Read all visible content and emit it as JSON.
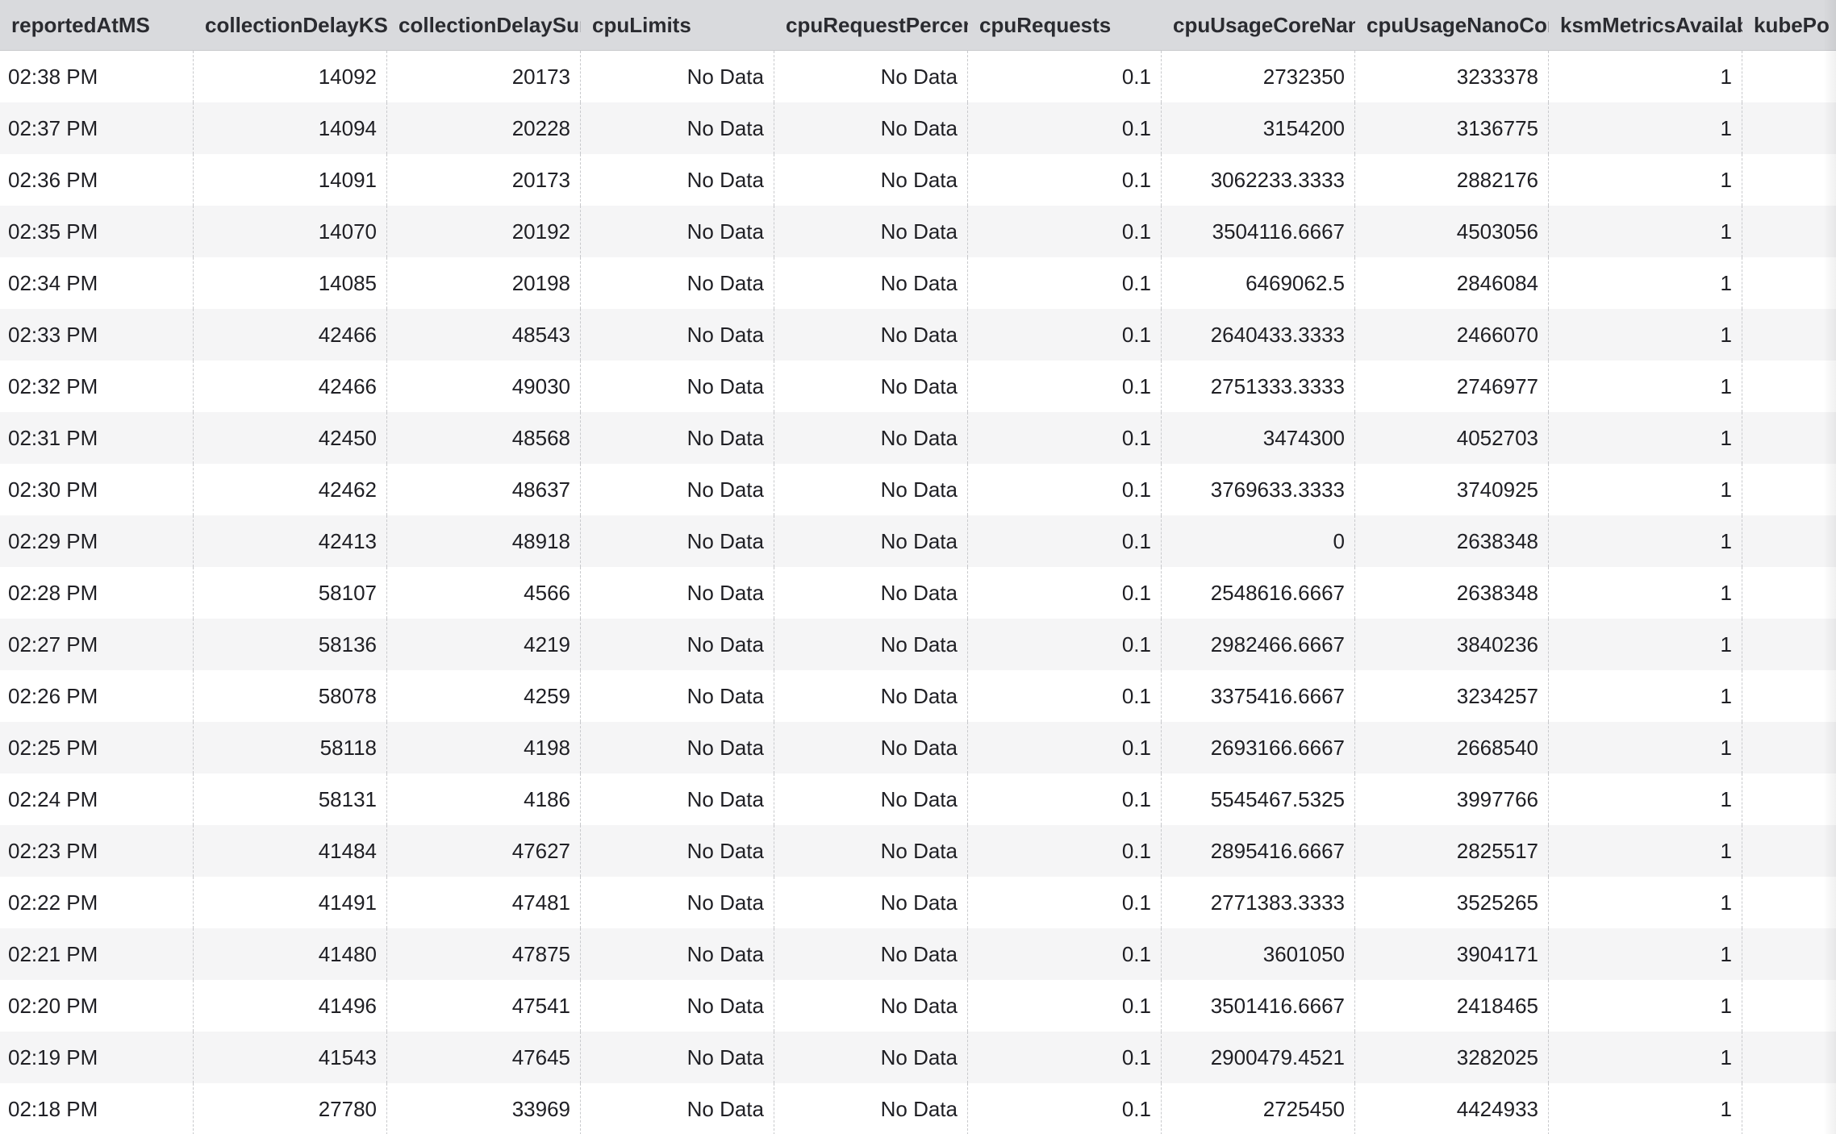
{
  "table": {
    "columns": [
      "reportedAtMS",
      "collectionDelayKSM",
      "collectionDelaySum",
      "cpuLimits",
      "cpuRequestPercent",
      "cpuRequests",
      "cpuUsageCoreNanos",
      "cpuUsageNanoCores",
      "ksmMetricsAvailable",
      "kubePo",
      ""
    ],
    "rows": [
      [
        "02:38 PM",
        "14092",
        "20173",
        "No Data",
        "No Data",
        "0.1",
        "2732350",
        "3233378",
        "1",
        "",
        ""
      ],
      [
        "02:37 PM",
        "14094",
        "20228",
        "No Data",
        "No Data",
        "0.1",
        "3154200",
        "3136775",
        "1",
        "",
        ""
      ],
      [
        "02:36 PM",
        "14091",
        "20173",
        "No Data",
        "No Data",
        "0.1",
        "3062233.3333",
        "2882176",
        "1",
        "",
        ""
      ],
      [
        "02:35 PM",
        "14070",
        "20192",
        "No Data",
        "No Data",
        "0.1",
        "3504116.6667",
        "4503056",
        "1",
        "",
        ""
      ],
      [
        "02:34 PM",
        "14085",
        "20198",
        "No Data",
        "No Data",
        "0.1",
        "6469062.5",
        "2846084",
        "1",
        "",
        ""
      ],
      [
        "02:33 PM",
        "42466",
        "48543",
        "No Data",
        "No Data",
        "0.1",
        "2640433.3333",
        "2466070",
        "1",
        "",
        ""
      ],
      [
        "02:32 PM",
        "42466",
        "49030",
        "No Data",
        "No Data",
        "0.1",
        "2751333.3333",
        "2746977",
        "1",
        "",
        ""
      ],
      [
        "02:31 PM",
        "42450",
        "48568",
        "No Data",
        "No Data",
        "0.1",
        "3474300",
        "4052703",
        "1",
        "",
        ""
      ],
      [
        "02:30 PM",
        "42462",
        "48637",
        "No Data",
        "No Data",
        "0.1",
        "3769633.3333",
        "3740925",
        "1",
        "",
        ""
      ],
      [
        "02:29 PM",
        "42413",
        "48918",
        "No Data",
        "No Data",
        "0.1",
        "0",
        "2638348",
        "1",
        "",
        ""
      ],
      [
        "02:28 PM",
        "58107",
        "4566",
        "No Data",
        "No Data",
        "0.1",
        "2548616.6667",
        "2638348",
        "1",
        "",
        ""
      ],
      [
        "02:27 PM",
        "58136",
        "4219",
        "No Data",
        "No Data",
        "0.1",
        "2982466.6667",
        "3840236",
        "1",
        "",
        ""
      ],
      [
        "02:26 PM",
        "58078",
        "4259",
        "No Data",
        "No Data",
        "0.1",
        "3375416.6667",
        "3234257",
        "1",
        "",
        ""
      ],
      [
        "02:25 PM",
        "58118",
        "4198",
        "No Data",
        "No Data",
        "0.1",
        "2693166.6667",
        "2668540",
        "1",
        "",
        ""
      ],
      [
        "02:24 PM",
        "58131",
        "4186",
        "No Data",
        "No Data",
        "0.1",
        "5545467.5325",
        "3997766",
        "1",
        "",
        ""
      ],
      [
        "02:23 PM",
        "41484",
        "47627",
        "No Data",
        "No Data",
        "0.1",
        "2895416.6667",
        "2825517",
        "1",
        "",
        ""
      ],
      [
        "02:22 PM",
        "41491",
        "47481",
        "No Data",
        "No Data",
        "0.1",
        "2771383.3333",
        "3525265",
        "1",
        "",
        ""
      ],
      [
        "02:21 PM",
        "41480",
        "47875",
        "No Data",
        "No Data",
        "0.1",
        "3601050",
        "3904171",
        "1",
        "",
        ""
      ],
      [
        "02:20 PM",
        "41496",
        "47541",
        "No Data",
        "No Data",
        "0.1",
        "3501416.6667",
        "2418465",
        "1",
        "",
        ""
      ],
      [
        "02:19 PM",
        "41543",
        "47645",
        "No Data",
        "No Data",
        "0.1",
        "2900479.4521",
        "3282025",
        "1",
        "",
        ""
      ],
      [
        "02:18 PM",
        "27780",
        "33969",
        "No Data",
        "No Data",
        "0.1",
        "2725450",
        "4424933",
        "1",
        "",
        ""
      ]
    ]
  }
}
